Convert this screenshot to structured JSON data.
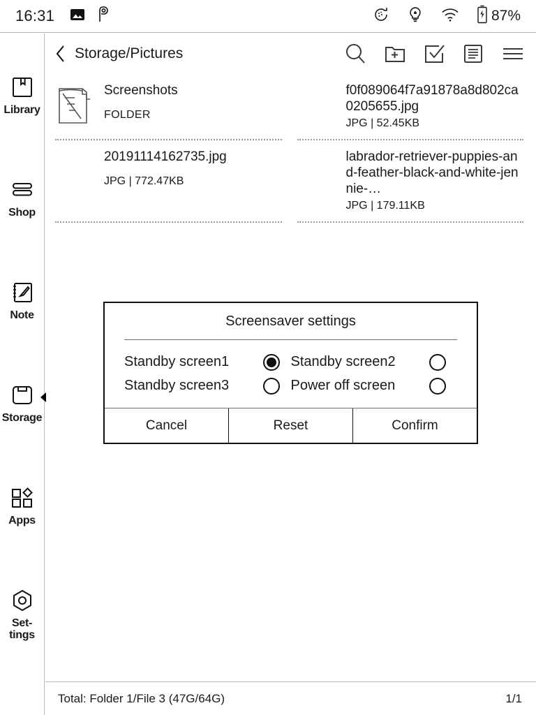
{
  "statusbar": {
    "time": "16:31",
    "icons": [
      "image-icon",
      "p-badge-icon"
    ],
    "right_icons": [
      "refresh-rotate-icon",
      "frontlight-bulb-icon",
      "wifi-icon",
      "battery-charging-icon"
    ],
    "battery_text": "87%"
  },
  "sidebar": {
    "items": [
      {
        "label": "Library",
        "icon": "library-book-icon",
        "selected": false
      },
      {
        "label": "Shop",
        "icon": "shop-books-icon",
        "selected": false
      },
      {
        "label": "Note",
        "icon": "note-pen-icon",
        "selected": false
      },
      {
        "label": "Storage",
        "icon": "storage-floppy-icon",
        "selected": true
      },
      {
        "label": "Apps",
        "icon": "apps-grid-icon",
        "selected": false
      },
      {
        "label": "Set-\ntings",
        "icon": "settings-hex-icon",
        "selected": false
      }
    ]
  },
  "topbar": {
    "back_icon": "chevron-left-icon",
    "breadcrumb": "Storage/Pictures",
    "tools": [
      {
        "name": "search-icon"
      },
      {
        "name": "new-folder-icon"
      },
      {
        "name": "select-check-icon"
      },
      {
        "name": "list-view-icon"
      },
      {
        "name": "menu-hamburger-icon"
      }
    ]
  },
  "files": [
    {
      "name": "Screenshots",
      "meta": "FOLDER",
      "type": "folder",
      "thumb": "folder-icon"
    },
    {
      "name": "f0f089064f7a91878a8d802ca0205655.jpg",
      "meta": "JPG | 52.45KB",
      "type": "file",
      "thumb": "dog-photo-thumbnail"
    },
    {
      "name": "20191114162735.jpg",
      "meta": "JPG | 772.47KB",
      "type": "file",
      "thumb": "noise-photo-thumbnail"
    },
    {
      "name": "labrador-retriever-puppies-and-feather-black-and-white-jennie-…",
      "meta": "JPG | 179.11KB",
      "type": "file",
      "thumb": "puppies-photo-thumbnail"
    }
  ],
  "modal": {
    "title": "Screensaver settings",
    "options": [
      {
        "label": "Standby screen1",
        "selected": true
      },
      {
        "label": "Standby screen2",
        "selected": false
      },
      {
        "label": "Standby screen3",
        "selected": false
      },
      {
        "label": "Power off screen",
        "selected": false
      }
    ],
    "buttons": [
      {
        "label": "Cancel"
      },
      {
        "label": "Reset"
      },
      {
        "label": "Confirm"
      }
    ]
  },
  "bottombar": {
    "total": "Total:  Folder 1/File 3  (47G/64G)",
    "page": "1/1"
  }
}
